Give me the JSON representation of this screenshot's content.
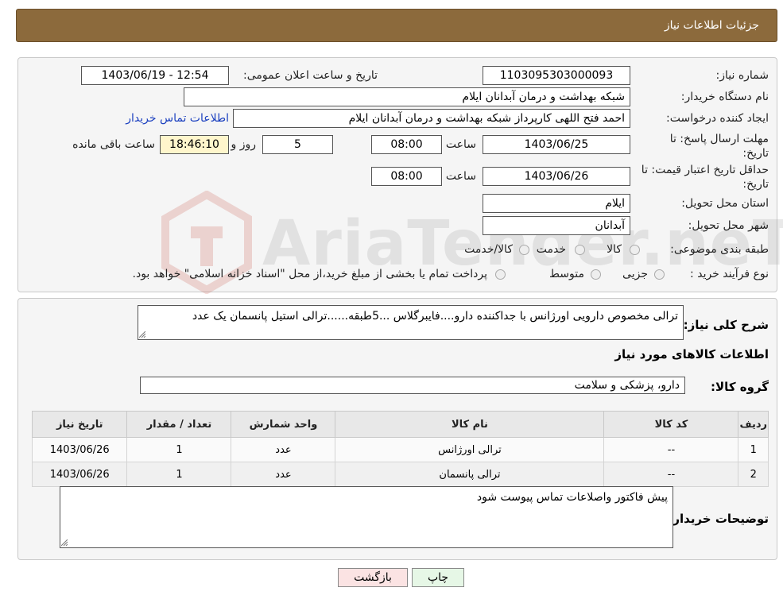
{
  "header": {
    "title": "جزئیات اطلاعات نیاز"
  },
  "form": {
    "need_number_label": "شماره نیاز:",
    "need_number": "1103095303000093",
    "announce_label": "تاریخ و ساعت اعلان عمومی:",
    "announce_value": "1403/06/19 - 12:54",
    "buyer_org_label": "نام دستگاه خریدار:",
    "buyer_org": "شبکه بهداشت و درمان آبدانان ایلام",
    "creator_label": "ایجاد کننده درخواست:",
    "creator": "احمد فتح اللهی کارپرداز شبکه بهداشت و درمان آبدانان ایلام",
    "contact_link": "اطلاعات تماس خریدار",
    "reply_deadline_label": "مهلت ارسال پاسخ: تا تاریخ:",
    "reply_date": "1403/06/25",
    "time_label": "ساعت",
    "reply_time": "08:00",
    "days_value": "5",
    "days_label": "روز و",
    "remaining_time": "18:46:10",
    "remaining_label": "ساعت باقی مانده",
    "price_validity_label": "حداقل تاریخ اعتبار قیمت: تا تاریخ:",
    "price_date": "1403/06/26",
    "price_time": "08:00",
    "province_label": "استان محل تحویل:",
    "province": "ایلام",
    "city_label": "شهر محل تحویل:",
    "city": "آبدانان",
    "category_label": "طبقه بندی موضوعی:",
    "category_options": [
      "کالا",
      "خدمت",
      "کالا/خدمت"
    ],
    "process_label": "نوع فرآیند خرید :",
    "process_options": [
      "جزیی",
      "متوسط"
    ],
    "process_note": "پرداخت تمام یا بخشی از مبلغ خرید،از محل \"اسناد خزانه اسلامی\" خواهد بود."
  },
  "watermark": {
    "text": "AriaTender.neT"
  },
  "details": {
    "summary_label": "شرح کلی نیاز:",
    "summary": "ترالی مخصوص دارویی اورژانس با جداکننده دارو....فایبرگلاس ...5طبقه......ترالی استیل پانسمان یک عدد",
    "goods_info_title": "اطلاعات کالاهای مورد نیاز",
    "goods_group_label": "گروه کالا:",
    "goods_group": "دارو، پزشکی و سلامت",
    "table": {
      "headers": [
        "ردیف",
        "کد کالا",
        "نام کالا",
        "واحد شمارش",
        "تعداد / مقدار",
        "تاریخ نیاز"
      ],
      "rows": [
        [
          "1",
          "--",
          "ترالی اورژانس",
          "عدد",
          "1",
          "1403/06/26"
        ],
        [
          "2",
          "--",
          "ترالی پانسمان",
          "عدد",
          "1",
          "1403/06/26"
        ]
      ]
    },
    "buyer_notes_label": "توضیحات خریدار:",
    "buyer_notes": "پیش فاکتور واصلاعات تماس پیوست شود"
  },
  "buttons": {
    "print": "چاپ",
    "back": "بازگشت"
  },
  "colors": {
    "header_bg": "#8c6a3c",
    "link": "#1a3fbf",
    "print_bg": "#e6f7e6",
    "back_bg": "#fbe3e3",
    "timer_bg": "#fff6cc"
  }
}
